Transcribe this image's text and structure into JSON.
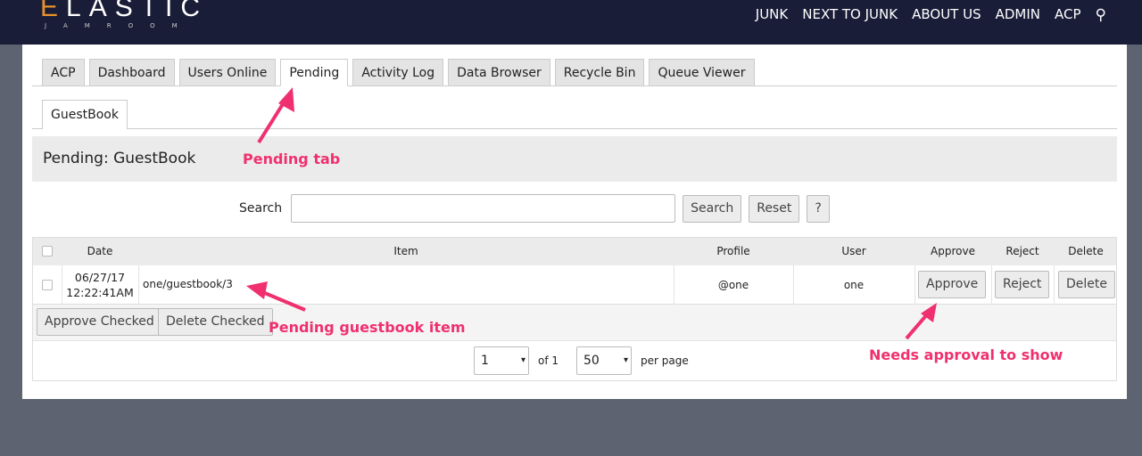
{
  "logo": {
    "main": "ELASTIC",
    "sub": "JAMROOM"
  },
  "nav": [
    "JUNK",
    "NEXT TO JUNK",
    "ABOUT US",
    "ADMIN",
    "ACP"
  ],
  "tabs": [
    "ACP",
    "Dashboard",
    "Users Online",
    "Pending",
    "Activity Log",
    "Data Browser",
    "Recycle Bin",
    "Queue Viewer"
  ],
  "subtab": "GuestBook",
  "page_title": "Pending: GuestBook",
  "search": {
    "label": "Search",
    "value": "",
    "search_btn": "Search",
    "reset_btn": "Reset",
    "help_btn": "?"
  },
  "table": {
    "headers": {
      "date": "Date",
      "item": "Item",
      "profile": "Profile",
      "user": "User",
      "approve": "Approve",
      "reject": "Reject",
      "delete": "Delete"
    },
    "row": {
      "date1": "06/27/17",
      "date2": "12:22:41AM",
      "item": "one/guestbook/3",
      "profile": "@one",
      "user": "one",
      "approve": "Approve",
      "reject": "Reject",
      "delete": "Delete"
    }
  },
  "bulk": {
    "approve": "Approve Checked",
    "delete": "Delete Checked"
  },
  "pager": {
    "page": "1",
    "of": "of 1",
    "per": "50",
    "per_label": "per page"
  },
  "annotations": {
    "pending_tab": "Pending tab",
    "item": "Pending guestbook item",
    "approval": "Needs approval to show"
  },
  "colors": {
    "header": "#191d38",
    "accent": "#f0306e"
  }
}
